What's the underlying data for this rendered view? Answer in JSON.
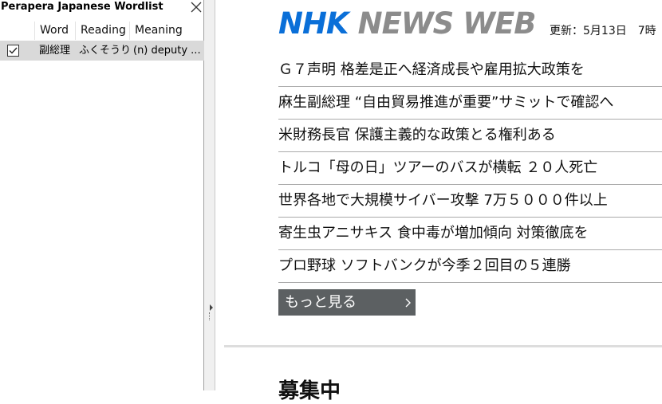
{
  "sidebar": {
    "title": "Perapera Japanese Wordlist",
    "columns": {
      "word": "Word",
      "reading": "Reading",
      "meaning": "Meaning"
    },
    "rows": [
      {
        "checked": true,
        "word": "副総理",
        "reading": "ふくそうり",
        "meaning": "(n) deputy ..."
      }
    ]
  },
  "main": {
    "logo": {
      "nhk": "NHK",
      "news_web": "NEWS WEB",
      "nhk_color": "#0a6fd8",
      "news_color": "#8c8c8c"
    },
    "update_text": "更新：5月13日　7時",
    "news": [
      "Ｇ７声明 格差是正へ経済成長や雇用拡大政策を",
      "麻生副総理 “自由貿易推進が重要”サミットで確認へ",
      "米財務長官 保護主義的な政策とる権利ある",
      "トルコ「母の日」ツアーのバスが横転 ２０人死亡",
      "世界各地で大規模サイバー攻撃 7万５０００件以上",
      "寄生虫アニサキス 食中毒が増加傾向 対策徹底を",
      "プロ野球 ソフトバンクが今季２回目の５連勝"
    ],
    "more_button": "もっと見る",
    "more_button_color": "#5c6062",
    "section_heading": "募集中"
  }
}
